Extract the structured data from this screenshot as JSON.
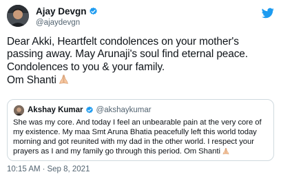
{
  "tweet": {
    "author": {
      "name": "Ajay Devgn",
      "handle": "@ajaydevgn"
    },
    "text": "Dear Akki, Heartfelt condolences on your mother's passing away.  May Arunaji's soul find eternal peace.\nCondolences to you & your family.\nOm Shanti",
    "quoted": {
      "name": "Akshay Kumar",
      "handle": "@akshaykumar",
      "text": "She was my core. And today I feel an unbearable pain at the very core of my existence. My maa Smt Aruna Bhatia peacefully left this world today morning and got reunited with my dad in the other world. I respect your prayers as I and my family go through this period. Om Shanti"
    },
    "time": "10:15 AM",
    "separator": "·",
    "date": "Sep 8, 2021"
  },
  "colors": {
    "accent": "#1d9bf0",
    "secondary_text": "#536471",
    "border": "#cfd9de"
  },
  "icons": {
    "brand": "twitter-bird-icon",
    "verified": "verified-badge-icon",
    "emoji": "folded-hands-emoji"
  }
}
